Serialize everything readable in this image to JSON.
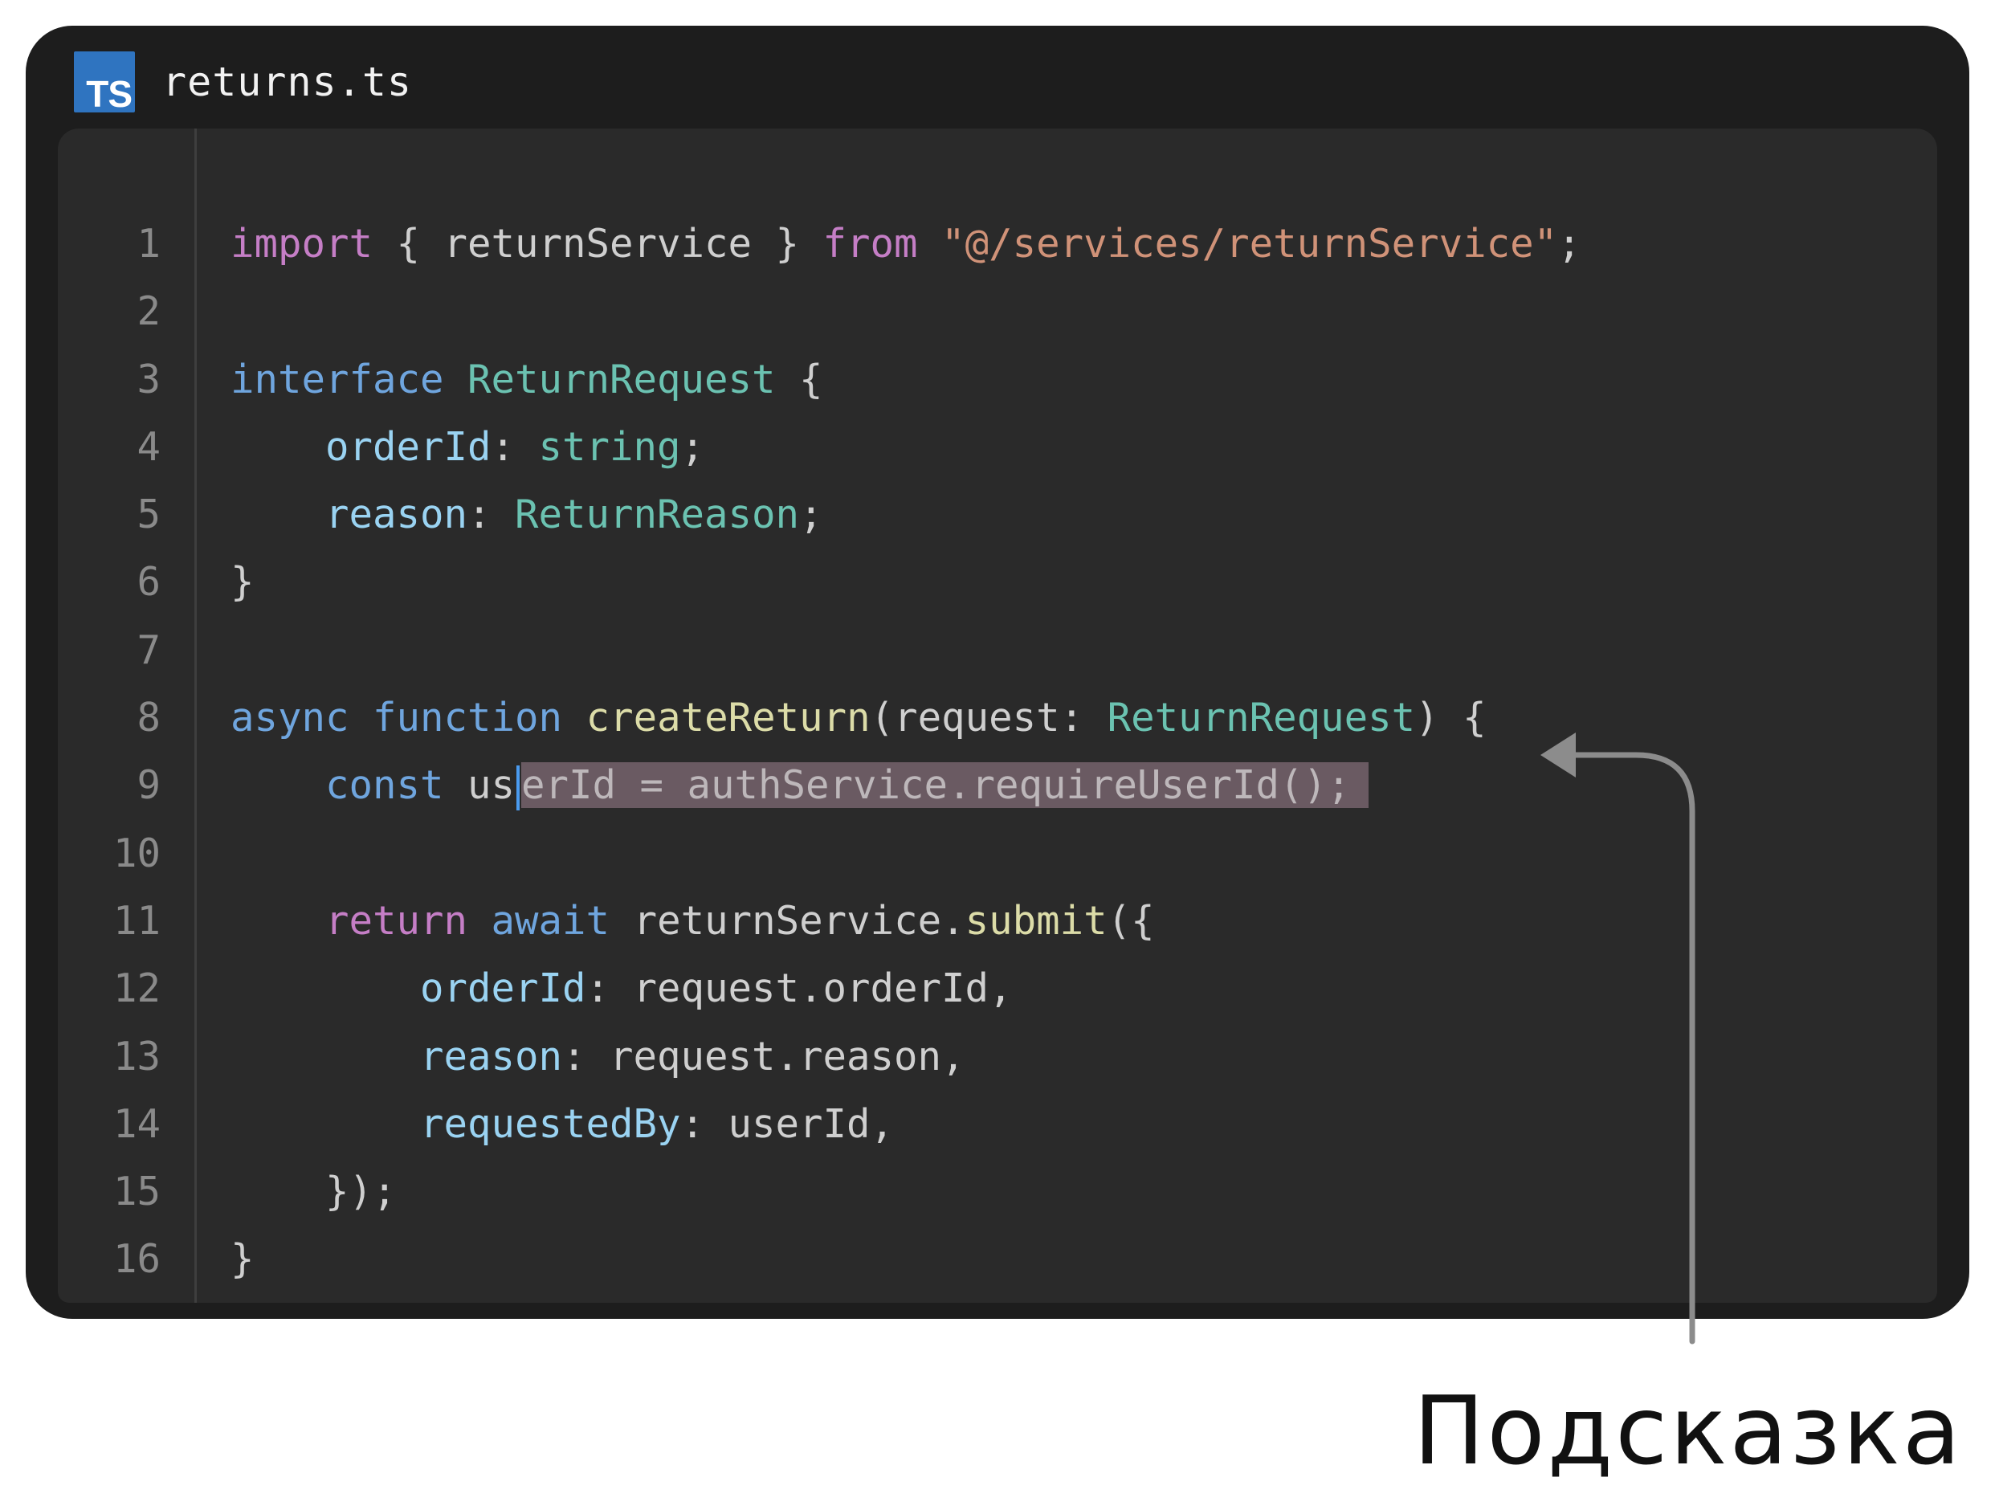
{
  "tab": {
    "icon_label": "TS",
    "filename": "returns.ts"
  },
  "code_lines": [
    {
      "n": "1",
      "tokens": [
        [
          "kw-p",
          "import"
        ],
        [
          "pl",
          " { returnService } "
        ],
        [
          "kw-p",
          "from"
        ],
        [
          "pl",
          " "
        ],
        [
          "str",
          "\"@/services/returnService\""
        ],
        [
          "pl",
          ";"
        ]
      ]
    },
    {
      "n": "2",
      "tokens": []
    },
    {
      "n": "3",
      "tokens": [
        [
          "kw-b",
          "interface"
        ],
        [
          "pl",
          " "
        ],
        [
          "ty",
          "ReturnRequest"
        ],
        [
          "pl",
          " {"
        ]
      ]
    },
    {
      "n": "4",
      "tokens": [
        [
          "pl",
          "    "
        ],
        [
          "prop",
          "orderId"
        ],
        [
          "pl",
          ": "
        ],
        [
          "ty",
          "string"
        ],
        [
          "pl",
          ";"
        ]
      ]
    },
    {
      "n": "5",
      "tokens": [
        [
          "pl",
          "    "
        ],
        [
          "prop",
          "reason"
        ],
        [
          "pl",
          ": "
        ],
        [
          "ty",
          "ReturnReason"
        ],
        [
          "pl",
          ";"
        ]
      ]
    },
    {
      "n": "6",
      "tokens": [
        [
          "pl",
          "}"
        ]
      ]
    },
    {
      "n": "7",
      "tokens": []
    },
    {
      "n": "8",
      "tokens": [
        [
          "kw-b",
          "async"
        ],
        [
          "pl",
          " "
        ],
        [
          "kw-b",
          "function"
        ],
        [
          "pl",
          " "
        ],
        [
          "fn",
          "createReturn"
        ],
        [
          "pl",
          "(request: "
        ],
        [
          "ty",
          "ReturnRequest"
        ],
        [
          "pl",
          ") {"
        ]
      ]
    },
    {
      "n": "9",
      "tokens": [
        [
          "pl",
          "    "
        ],
        [
          "kw-b",
          "const"
        ],
        [
          "pl",
          " us"
        ],
        [
          "cursor",
          ""
        ],
        [
          "hint",
          "erId = authService.requireUserId();"
        ]
      ]
    },
    {
      "n": "10",
      "tokens": []
    },
    {
      "n": "11",
      "tokens": [
        [
          "pl",
          "    "
        ],
        [
          "kw-p",
          "return"
        ],
        [
          "pl",
          " "
        ],
        [
          "kw-b",
          "await"
        ],
        [
          "pl",
          " returnService."
        ],
        [
          "fn",
          "submit"
        ],
        [
          "pl",
          "({"
        ]
      ]
    },
    {
      "n": "12",
      "tokens": [
        [
          "pl",
          "        "
        ],
        [
          "prop",
          "orderId"
        ],
        [
          "pl",
          ": request.orderId,"
        ]
      ]
    },
    {
      "n": "13",
      "tokens": [
        [
          "pl",
          "        "
        ],
        [
          "prop",
          "reason"
        ],
        [
          "pl",
          ": request.reason,"
        ]
      ]
    },
    {
      "n": "14",
      "tokens": [
        [
          "pl",
          "        "
        ],
        [
          "prop",
          "requestedBy"
        ],
        [
          "pl",
          ": userId,"
        ]
      ]
    },
    {
      "n": "15",
      "tokens": [
        [
          "pl",
          "    });"
        ]
      ]
    },
    {
      "n": "16",
      "tokens": [
        [
          "pl",
          "}"
        ]
      ]
    }
  ],
  "callout": {
    "label": "Подсказка"
  },
  "colors": {
    "keyword_pink": "#c57ec6",
    "keyword_blue": "#6fa5de",
    "type_teal": "#6bc2b1",
    "property_lightblue": "#9ad3f2",
    "string_orange": "#d09278",
    "function_yellow": "#dcdca8",
    "hint_background": "#6a5a62",
    "cursor_blue": "#4a9bf0"
  }
}
